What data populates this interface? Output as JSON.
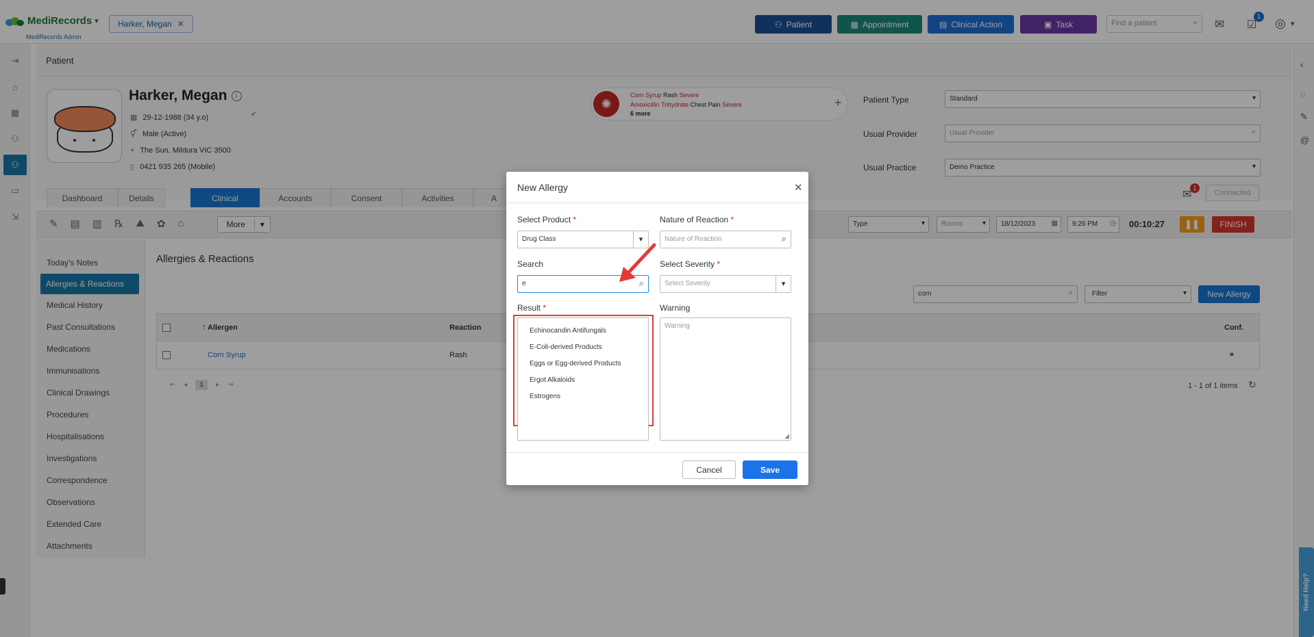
{
  "app": {
    "name": "MediRecords",
    "subtitle": "MediRecords Admin"
  },
  "header": {
    "patient_chip": "Harker, Megan",
    "buttons": [
      {
        "label": "Patient",
        "color": "#1a4f96"
      },
      {
        "label": "Appointment",
        "color": "#1b8a7a"
      },
      {
        "label": "Clinical Action",
        "color": "#1e6fd6"
      },
      {
        "label": "Task",
        "color": "#6b37a6"
      }
    ],
    "search_placeholder": "Find a patient",
    "task_badge": "1"
  },
  "page": {
    "title": "Patient"
  },
  "patient": {
    "name": "Harker, Megan",
    "dob": "29-12-1988 (34 y.o)",
    "gender": "Male (Active)",
    "address": "The Sun, Mildura VIC 3500",
    "phone": "0421 935 265 (Mobile)",
    "allergies": [
      {
        "name": "Corn Syrup",
        "reaction": "Rash",
        "severity": "Severe"
      },
      {
        "name": "Amoxicillin Trihydrate",
        "reaction": "Chest Pain",
        "severity": "Severe"
      }
    ],
    "more": "6 more",
    "patient_type_label": "Patient Type",
    "patient_type": "Standard",
    "usual_provider_label": "Usual Provider",
    "usual_provider_placeholder": "Usual Provider",
    "usual_practice_label": "Usual Practice",
    "usual_practice": "Demo Practice",
    "connected": "Connected",
    "mail_badge": "1"
  },
  "tabs": [
    "Dashboard",
    "Details",
    "Clinical",
    "Accounts",
    "Consent",
    "Activities",
    "A"
  ],
  "toolbar": {
    "more": "More",
    "type": "Type",
    "rooms": "Rooms",
    "date": "18/12/2023",
    "time": "9:26 PM",
    "timer": "00:10:27",
    "finish": "FINISH"
  },
  "sidenav": [
    "Today's Notes",
    "Allergies & Reactions",
    "Medical History",
    "Past Consultations",
    "Medications",
    "Immunisations",
    "Clinical Drawings",
    "Procedures",
    "Hospitalisations",
    "Investigations",
    "Correspondence",
    "Observations",
    "Extended Care",
    "Attachments"
  ],
  "allergies_section": {
    "title": "Allergies & Reactions",
    "search_value": "corn",
    "filter": "Filter",
    "new_button": "New Allergy",
    "columns": [
      "Allergen",
      "Reaction",
      "Conf."
    ],
    "rows": [
      {
        "allergen": "Corn Syrup",
        "reaction": "Rash"
      }
    ],
    "page": "1",
    "items_count": "1 - 1 of 1 items"
  },
  "modal": {
    "title": "New Allergy",
    "select_product_label": "Select Product",
    "select_product_value": "Drug Class",
    "nature_label": "Nature of Reaction",
    "nature_placeholder": "Nature of Reaction",
    "search_label": "Search",
    "search_value": "e",
    "severity_label": "Select Severity",
    "severity_placeholder": "Select Severity",
    "result_label": "Result",
    "results": [
      "Echinocandin Antifungals",
      "E-Coli-derived Products",
      "Eggs or Egg-derived Products",
      "Ergot Alkaloids",
      "Estrogens"
    ],
    "warning_label": "Warning",
    "warning_placeholder": "Warning",
    "cancel": "Cancel",
    "save": "Save",
    "required_mark": "*"
  },
  "help_tab": "Need Help?"
}
